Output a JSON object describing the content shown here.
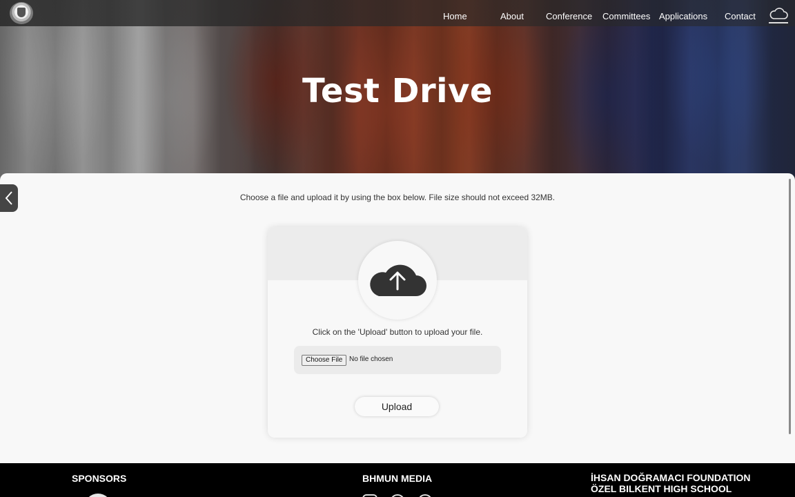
{
  "nav": {
    "links": [
      "Home",
      "About",
      "Conference",
      "Committees",
      "Applications",
      "Contact"
    ],
    "logo_icon": "school-crest-icon",
    "cloud_icon": "cloud-icon"
  },
  "hero": {
    "title": "Test Drive"
  },
  "main": {
    "intro": "Choose a file and upload it by using the box below. File size should not exceed 32MB.",
    "back_icon": "chevron-left-icon"
  },
  "upload": {
    "icon": "cloud-upload-icon",
    "instruction": "Click on the 'Upload' button to upload your file.",
    "choose_label": "Choose File",
    "file_status": "No file chosen",
    "upload_label": "Upload"
  },
  "footer": {
    "sponsors_heading": "SPONSORS",
    "media_heading": "BHMUN MEDIA",
    "school_line1": "İHSAN DOĞRAMACI FOUNDATION",
    "school_line2": "ÖZEL BILKENT HIGH SCHOOL"
  },
  "colors": {
    "footer_bg": "#000000",
    "icon_dark": "#333333",
    "panel_bg": "#f8f8f8"
  }
}
